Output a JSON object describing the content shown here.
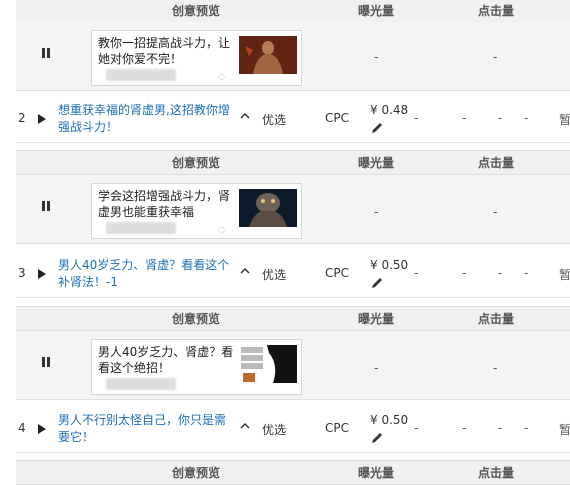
{
  "headers": {
    "preview": "创意预览",
    "impressions": "曝光量",
    "clicks": "点击量"
  },
  "creatives": [
    {
      "text": "教你一招提高战斗力，让她对你爱不完！",
      "impressions": "-",
      "clicks": "-"
    },
    {
      "text": "学会这招增强战斗力，肾虚男也能重获幸福",
      "impressions": "-",
      "clicks": "-"
    },
    {
      "text": "男人40岁乏力、肾虚？看看这个绝招！",
      "impressions": "-",
      "clicks": "-"
    }
  ],
  "ads": [
    {
      "num": "2",
      "title": "想重获幸福的肾虚男,这招教你增强战斗力！",
      "tier": "优选",
      "billing": "CPC",
      "price": "¥ 0.48",
      "dashes": [
        "-",
        "-",
        "-",
        "-",
        "-"
      ],
      "status": "暂"
    },
    {
      "num": "3",
      "title": "男人40岁乏力、肾虚？看看这个补肾法！-1",
      "tier": "优选",
      "billing": "CPC",
      "price": "¥ 0.50",
      "dashes": [
        "-",
        "-",
        "-",
        "-",
        "-"
      ],
      "status": "暂"
    },
    {
      "num": "4",
      "title": "男人不行别太怪自己，你只是需要它！",
      "tier": "优选",
      "billing": "CPC",
      "price": "¥ 0.50",
      "dashes": [
        "-",
        "-",
        "-",
        "-",
        "-"
      ],
      "status": "暂"
    }
  ],
  "icons": {
    "pause": "pause-icon",
    "play": "play-icon",
    "chevron": "chevron-up-icon",
    "edit": "pencil-icon"
  },
  "colors": {
    "link": "#1d6fb8",
    "header_bg": "#eef0f1"
  }
}
